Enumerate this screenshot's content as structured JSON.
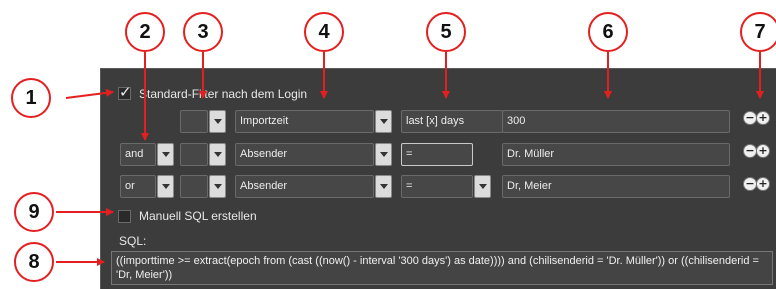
{
  "login_filter": {
    "label": "Standard-Filter nach dem Login",
    "checked": true
  },
  "filter_rows": [
    {
      "conjunction": "",
      "paren": "",
      "field": "Importzeit",
      "operator": "last [x] days",
      "value": "300"
    },
    {
      "conjunction": "and",
      "paren": "",
      "field": "Absender",
      "operator": "=",
      "value": "Dr. Müller"
    },
    {
      "conjunction": "or",
      "paren": "",
      "field": "Absender",
      "operator": "=",
      "value": "Dr, Meier"
    }
  ],
  "manual_sql": {
    "label": "Manuell SQL erstellen",
    "checked": false
  },
  "sql": {
    "label": "SQL:",
    "text": "((importtime >= extract(epoch from (cast ((now() - interval '300 days') as date)))) and (chilisenderid = 'Dr. Müller')) or ((chilisenderid = 'Dr, Meier'))"
  },
  "row_buttons": {
    "minus": "−",
    "plus": "+"
  },
  "callouts": [
    "1",
    "2",
    "3",
    "4",
    "5",
    "6",
    "7",
    "8",
    "9"
  ],
  "colors": {
    "callout_red": "#e41f1f",
    "panel": "#3c3c3c"
  }
}
